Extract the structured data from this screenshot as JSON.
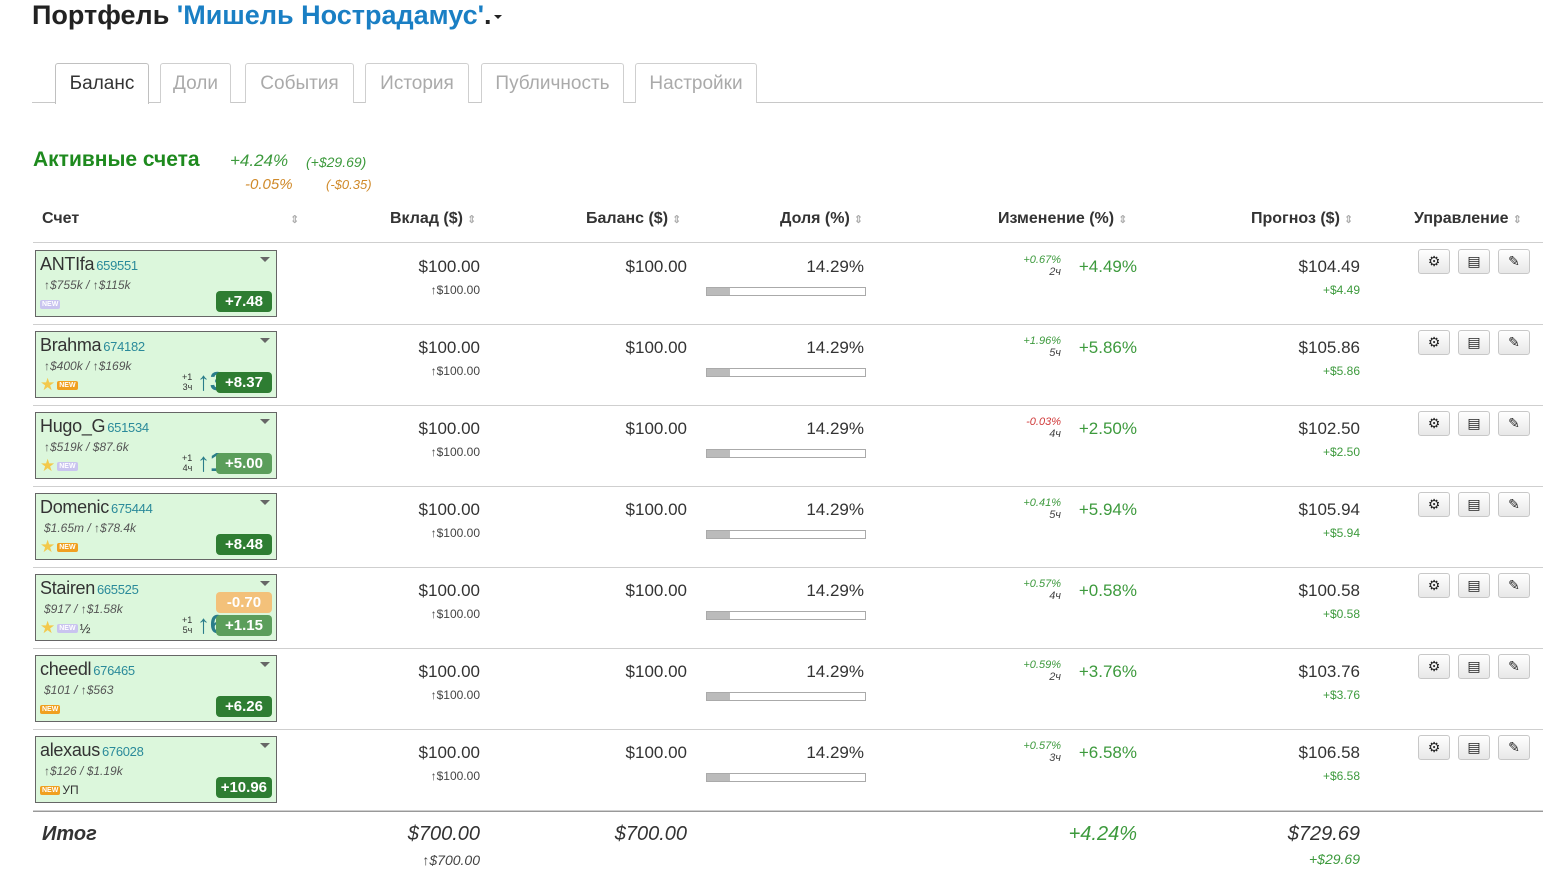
{
  "title": {
    "prefix": "Портфель ",
    "name": "'Мишель Нострадамус'",
    "suffix": "."
  },
  "tabs": [
    {
      "label": "Баланс",
      "active": true
    },
    {
      "label": "Доли",
      "active": false
    },
    {
      "label": "События",
      "active": false
    },
    {
      "label": "История",
      "active": false
    },
    {
      "label": "Публичность",
      "active": false
    },
    {
      "label": "Настройки",
      "active": false
    }
  ],
  "section": {
    "title": "Активные счета",
    "pct": "+4.24%",
    "abs": "(+$29.69)",
    "pct2": "-0.05%",
    "abs2": "(-$0.35)"
  },
  "columns": {
    "account": "Счет",
    "deposit": "Вклад ($)",
    "balance": "Баланс ($)",
    "share": "Доля (%)",
    "change": "Изменение (%)",
    "forecast": "Прогноз ($)",
    "manage": "Управление"
  },
  "rows": [
    {
      "name": "ANTIfa",
      "num": "659551",
      "money": "↑$755k / ↑$115k",
      "star": false,
      "newb": "lilac",
      "half": "",
      "up": "",
      "score": "+7.48",
      "scoreCls": "dark",
      "score2": "",
      "score2Cls": "",
      "streak1": "",
      "streak2": "",
      "bigarrow": "",
      "deposit": "$100.00",
      "deposit2": "↑$100.00",
      "balance": "$100.00",
      "share": "14.29%",
      "shareFrac": 0.1429,
      "chgSmall": "+0.67%",
      "chgSmallCls": "pos",
      "chgHours": "2ч",
      "chg": "+4.49%",
      "forecast": "$104.49",
      "forecast2": "+$4.49"
    },
    {
      "name": "Brahma",
      "num": "674182",
      "money": "↑$400k / ↑$169k",
      "star": true,
      "newb": "orange",
      "half": "",
      "up": "",
      "score": "+8.37",
      "scoreCls": "dark",
      "score2": "",
      "score2Cls": "",
      "streak1": "+1",
      "streak2": "3ч",
      "bigarrow": "↑3",
      "deposit": "$100.00",
      "deposit2": "↑$100.00",
      "balance": "$100.00",
      "share": "14.29%",
      "shareFrac": 0.1429,
      "chgSmall": "+1.96%",
      "chgSmallCls": "pos",
      "chgHours": "5ч",
      "chg": "+5.86%",
      "forecast": "$105.86",
      "forecast2": "+$5.86"
    },
    {
      "name": "Hugo_G",
      "num": "651534",
      "money": "↑$519k / $87.6k",
      "star": true,
      "newb": "lilac",
      "half": "",
      "up": "",
      "score": "+5.00",
      "scoreCls": "mid",
      "score2": "",
      "score2Cls": "",
      "streak1": "+1",
      "streak2": "4ч",
      "bigarrow": "↑1",
      "deposit": "$100.00",
      "deposit2": "↑$100.00",
      "balance": "$100.00",
      "share": "14.29%",
      "shareFrac": 0.1429,
      "chgSmall": "-0.03%",
      "chgSmallCls": "neg",
      "chgHours": "4ч",
      "chg": "+2.50%",
      "forecast": "$102.50",
      "forecast2": "+$2.50"
    },
    {
      "name": "Domenic",
      "num": "675444",
      "money": "$1.65m / ↑$78.4k",
      "star": true,
      "newb": "orange",
      "half": "",
      "up": "",
      "score": "+8.48",
      "scoreCls": "dark",
      "score2": "",
      "score2Cls": "",
      "streak1": "",
      "streak2": "",
      "bigarrow": "",
      "deposit": "$100.00",
      "deposit2": "↑$100.00",
      "balance": "$100.00",
      "share": "14.29%",
      "shareFrac": 0.1429,
      "chgSmall": "+0.41%",
      "chgSmallCls": "pos",
      "chgHours": "5ч",
      "chg": "+5.94%",
      "forecast": "$105.94",
      "forecast2": "+$5.94"
    },
    {
      "name": "Stairen",
      "num": "665525",
      "money": "$917 / ↑$1.58k",
      "star": true,
      "newb": "lilac",
      "half": "½",
      "up": "",
      "score": "+1.15",
      "scoreCls": "mid",
      "score2": "-0.70",
      "score2Cls": "neg",
      "streak1": "+1",
      "streak2": "5ч",
      "bigarrow": "↑6",
      "deposit": "$100.00",
      "deposit2": "↑$100.00",
      "balance": "$100.00",
      "share": "14.29%",
      "shareFrac": 0.1429,
      "chgSmall": "+0.57%",
      "chgSmallCls": "pos",
      "chgHours": "4ч",
      "chg": "+0.58%",
      "forecast": "$100.58",
      "forecast2": "+$0.58"
    },
    {
      "name": "cheedl",
      "num": "676465",
      "money": "$101 / ↑$563",
      "star": false,
      "newb": "orange",
      "half": "",
      "up": "",
      "score": "+6.26",
      "scoreCls": "dark",
      "score2": "",
      "score2Cls": "",
      "streak1": "",
      "streak2": "",
      "bigarrow": "",
      "deposit": "$100.00",
      "deposit2": "↑$100.00",
      "balance": "$100.00",
      "share": "14.29%",
      "shareFrac": 0.1429,
      "chgSmall": "+0.59%",
      "chgSmallCls": "pos",
      "chgHours": "2ч",
      "chg": "+3.76%",
      "forecast": "$103.76",
      "forecast2": "+$3.76"
    },
    {
      "name": "alexaus",
      "num": "676028",
      "money": "↑$126 / $1.19k",
      "star": false,
      "newb": "orange",
      "half": "",
      "up": "УП",
      "score": "+10.96",
      "scoreCls": "dark",
      "score2": "",
      "score2Cls": "",
      "streak1": "",
      "streak2": "",
      "bigarrow": "",
      "deposit": "$100.00",
      "deposit2": "↑$100.00",
      "balance": "$100.00",
      "share": "14.29%",
      "shareFrac": 0.1429,
      "chgSmall": "+0.57%",
      "chgSmallCls": "pos",
      "chgHours": "3ч",
      "chg": "+6.58%",
      "forecast": "$106.58",
      "forecast2": "+$6.58"
    }
  ],
  "newLabel": "NEW",
  "starGlyph": "★",
  "icons": {
    "settings": "gear-icon",
    "list": "list-icon",
    "edit": "pencil-icon"
  },
  "sortGlyph": "⇕",
  "totals": {
    "label": "Итог",
    "deposit": "$700.00",
    "deposit2": "↑$700.00",
    "balance": "$700.00",
    "change": "+4.24%",
    "forecast": "$729.69",
    "forecast2": "+$29.69"
  }
}
